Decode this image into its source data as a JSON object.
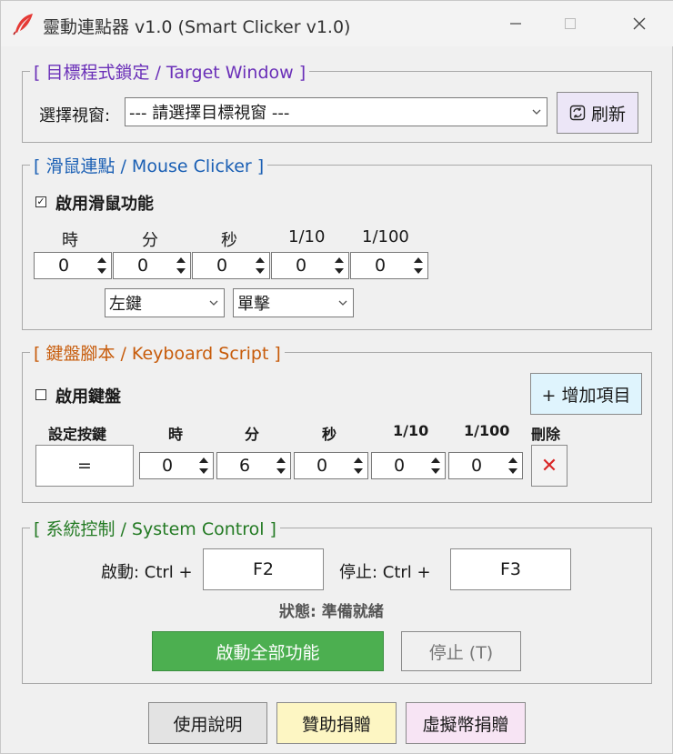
{
  "window": {
    "title": "靈動連點器 v1.0 (Smart Clicker v1.0)",
    "icon": "quill-feather-icon"
  },
  "target": {
    "legend": "[ 目標程式鎖定 / Target Window ]",
    "select_label": "選擇視窗:",
    "select_value": "--- 請選擇目標視窗 ---",
    "refresh_label": "刷新"
  },
  "mouse": {
    "legend": "[ 滑鼠連點 / Mouse Clicker ]",
    "enable_label": "啟用滑鼠功能",
    "enabled": true,
    "headers": [
      "時",
      "分",
      "秒",
      "1/10",
      "1/100"
    ],
    "values": [
      "0",
      "0",
      "0",
      "0",
      "0"
    ],
    "button_value": "左鍵",
    "click_value": "單擊"
  },
  "keyboard": {
    "legend": "[ 鍵盤腳本 / Keyboard Script ]",
    "enable_label": "啟用鍵盤",
    "enabled": false,
    "add_label": "+ 增加項目",
    "headers": [
      "設定按鍵",
      "時",
      "分",
      "秒",
      "1/10",
      "1/100",
      "刪除"
    ],
    "key_value": "=",
    "values": [
      "0",
      "6",
      "0",
      "0",
      "0"
    ],
    "delete_glyph": "✕"
  },
  "system": {
    "legend": "[ 系統控制 / System Control ]",
    "start_label": "啟動: Ctrl +",
    "start_key": "F2",
    "stop_label": "停止: Ctrl +",
    "stop_key": "F3",
    "status": "狀態: 準備就緒",
    "start_all": "啟動全部功能",
    "stop_btn": "停止 (T)"
  },
  "footer": {
    "help": "使用說明",
    "sponsor": "贊助捐贈",
    "crypto": "虛擬幣捐贈"
  },
  "colors": {
    "accent_green": "#4caf50",
    "sponsor_yellow": "#fdf6c3",
    "crypto_pink": "#f7e4f4",
    "add_blue": "#dff4fd",
    "refresh_lilac": "#ece6f7",
    "delete_red": "#d92626"
  }
}
